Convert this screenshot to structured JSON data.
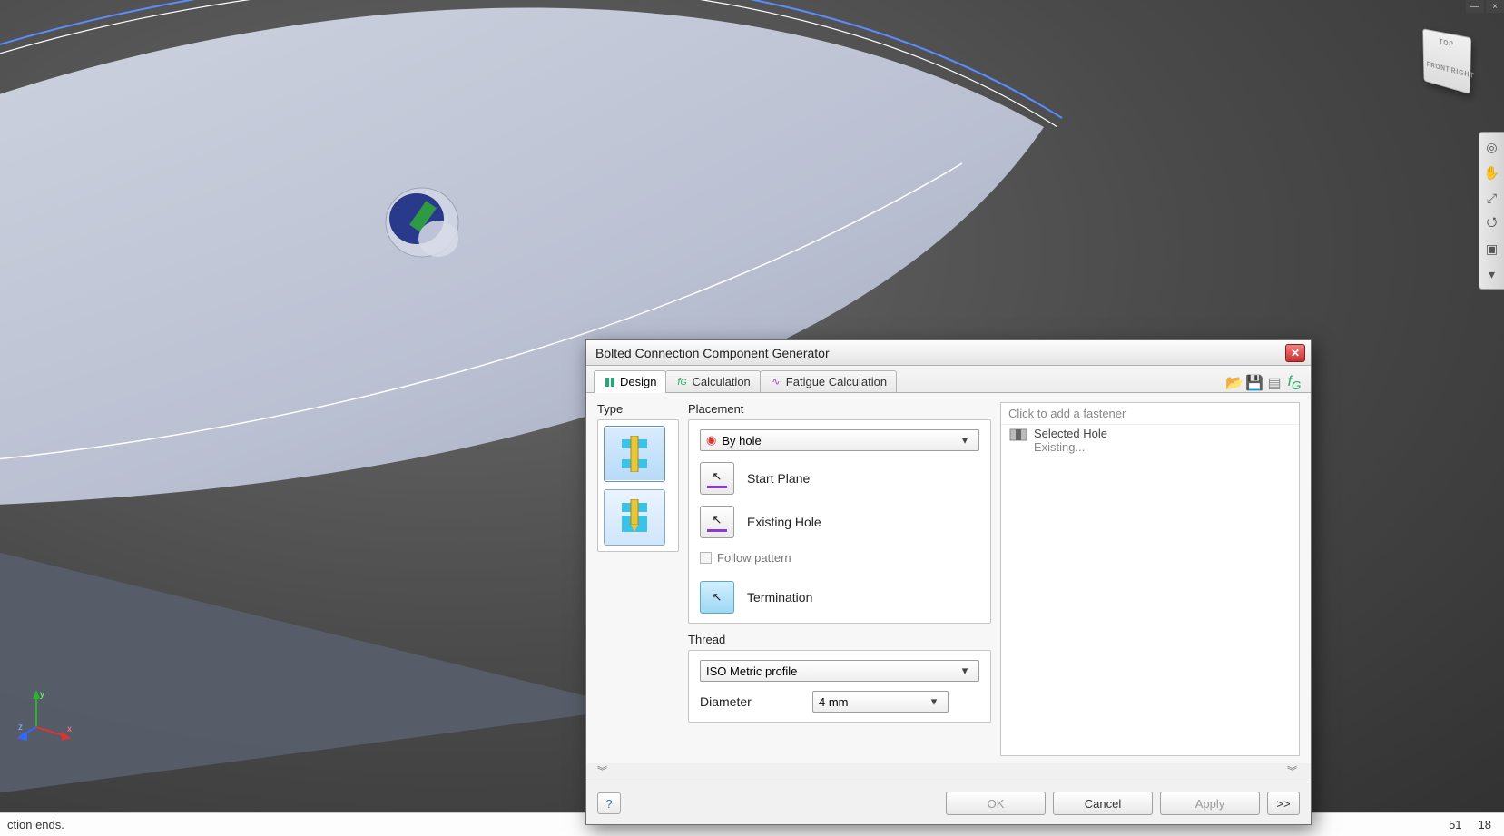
{
  "window_controls": {
    "minimize": "—",
    "close": "×"
  },
  "viewcube": {
    "top": "TOP",
    "front": "FRONT",
    "right": "RIGHT"
  },
  "statusbar": {
    "left": "ction ends.",
    "val1": "51",
    "val2": "18"
  },
  "axes": {
    "x": "x",
    "y": "y",
    "z": "z"
  },
  "dialog": {
    "title": "Bolted Connection Component Generator",
    "tabs": {
      "design": "Design",
      "calculation": "Calculation",
      "fatigue": "Fatigue Calculation"
    },
    "type": {
      "label": "Type"
    },
    "placement": {
      "label": "Placement",
      "mode": "By hole",
      "start_plane": "Start Plane",
      "existing_hole": "Existing Hole",
      "follow_pattern": "Follow pattern",
      "termination": "Termination"
    },
    "thread": {
      "label": "Thread",
      "profile": "ISO Metric profile",
      "diameter_label": "Diameter",
      "diameter_value": "4 mm"
    },
    "fastener": {
      "hint": "Click to add a fastener",
      "line1": "Selected Hole",
      "line2": "Existing..."
    },
    "buttons": {
      "ok": "OK",
      "cancel": "Cancel",
      "apply": "Apply",
      "more": ">>"
    }
  }
}
